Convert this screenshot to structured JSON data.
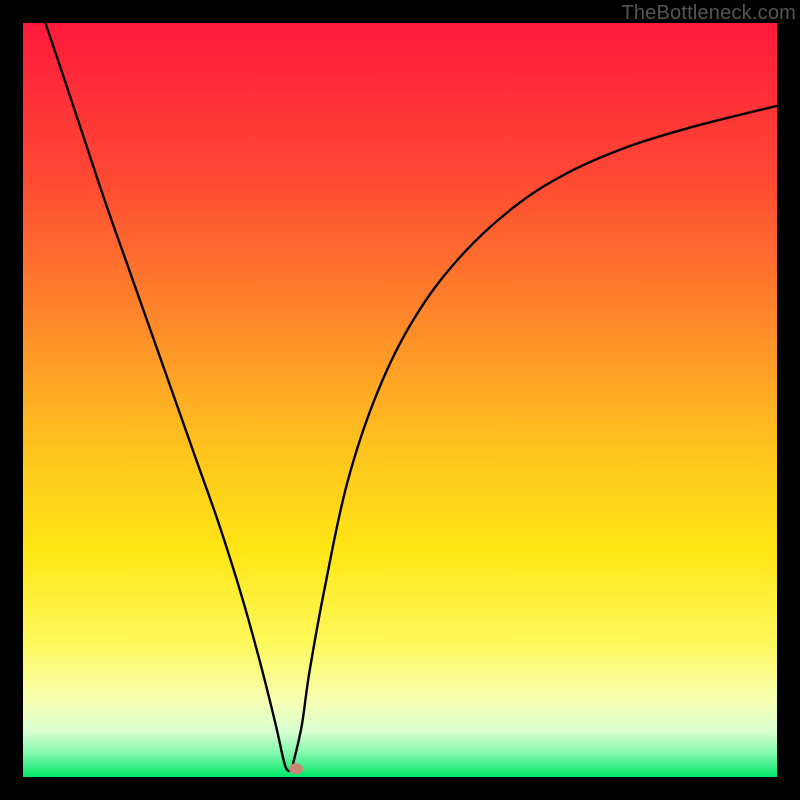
{
  "watermark": "TheBottleneck.com",
  "chart_data": {
    "type": "line",
    "title": "",
    "xlabel": "",
    "ylabel": "",
    "xlim": [
      0,
      100
    ],
    "ylim": [
      0,
      100
    ],
    "gradient_stops": [
      {
        "offset": 0,
        "color": "#ff1a3c"
      },
      {
        "offset": 20,
        "color": "#ff4733"
      },
      {
        "offset": 40,
        "color": "#ff8a2a"
      },
      {
        "offset": 55,
        "color": "#ffbf1f"
      },
      {
        "offset": 70,
        "color": "#ffe615"
      },
      {
        "offset": 82,
        "color": "#fff85a"
      },
      {
        "offset": 90,
        "color": "#f6ffb3"
      },
      {
        "offset": 94,
        "color": "#d7ffd0"
      },
      {
        "offset": 97,
        "color": "#7cf7a9"
      },
      {
        "offset": 100,
        "color": "#00e765"
      }
    ],
    "series": [
      {
        "name": "curve",
        "x": [
          0,
          2,
          5,
          8,
          11,
          14,
          17,
          20,
          23,
          26,
          29,
          31.5,
          33.5,
          34.5,
          35,
          35.5,
          36,
          37,
          38,
          40,
          43,
          47,
          52,
          58,
          65,
          72,
          80,
          88,
          95,
          100
        ],
        "y": [
          110,
          103,
          94,
          85,
          76,
          67.5,
          59,
          50.5,
          42,
          33.5,
          24,
          15,
          7,
          2.5,
          1,
          1,
          2.5,
          7,
          14,
          25,
          39,
          51,
          61,
          69,
          75.5,
          80,
          83.5,
          86,
          87.8,
          89
        ]
      }
    ],
    "marker": {
      "x": 36.2,
      "y": 1.1,
      "color": "#c78976"
    }
  }
}
